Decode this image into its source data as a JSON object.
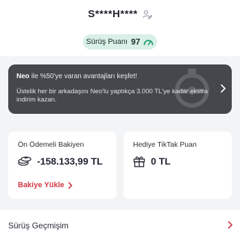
{
  "profile": {
    "username": "S****H****",
    "edit_icon": "person-edit-icon",
    "score_label": "Sürüş Puanı",
    "score_value": "97",
    "score_icon": "gauge-icon"
  },
  "promo": {
    "brand": "Neo",
    "title_rest": "ile %50'ye varan avantajları keşfet!",
    "description": "Üstelik her bir arkadaşını Neo'lu yaptıkça 3.000 TL'ye kadar ekstra indirim kazan.",
    "chevron_icon": "chevron-right-icon",
    "background_color": "#45474c"
  },
  "balance_card": {
    "label": "Ön Ödemeli Bakiyen",
    "value": "-158.133,99 TL",
    "icon": "coins-icon",
    "action_label": "Bakiye Yükle",
    "action_color": "#d33a48"
  },
  "gift_card": {
    "label": "Hediye TikTak Puan",
    "value": "0 TL",
    "icon": "gift-icon"
  },
  "history": {
    "label": "Sürüş Geçmişim",
    "chevron_icon": "chevron-right-icon",
    "chevron_color": "#d33a48"
  },
  "colors": {
    "accent_green_bg": "#d8f0e6",
    "accent_green": "#1e9b6b",
    "accent_red": "#d33a48",
    "page_bg": "#f3f4f6"
  }
}
